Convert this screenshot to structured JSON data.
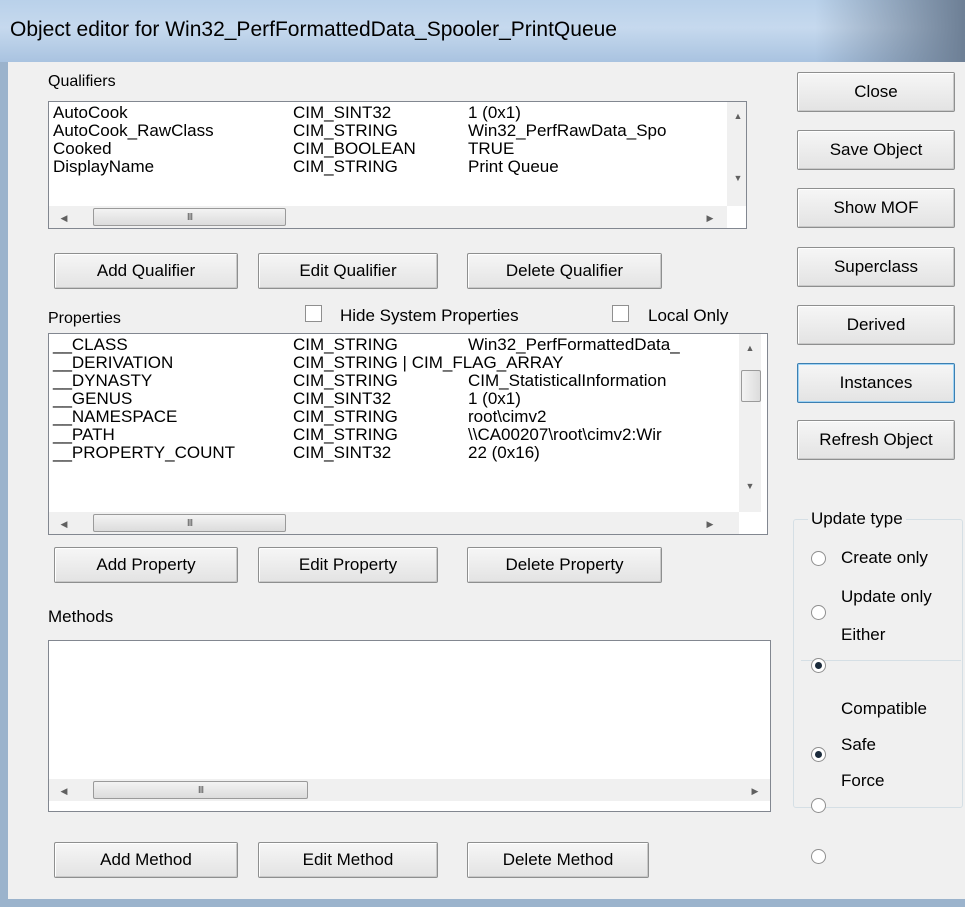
{
  "window": {
    "title": "Object editor for Win32_PerfFormattedData_Spooler_PrintQueue"
  },
  "qualifiers": {
    "label": "Qualifiers",
    "rows": [
      [
        "AutoCook",
        "CIM_SINT32",
        "1 (0x1)"
      ],
      [
        "AutoCook_RawClass",
        "CIM_STRING",
        "Win32_PerfRawData_Spo"
      ],
      [
        "Cooked",
        "CIM_BOOLEAN",
        "TRUE"
      ],
      [
        "DisplayName",
        "CIM_STRING",
        "Print Queue"
      ]
    ],
    "hthumb_glyph": "III",
    "add_label": "Add Qualifier",
    "edit_label": "Edit Qualifier",
    "delete_label": "Delete Qualifier"
  },
  "properties": {
    "label": "Properties",
    "hide_system_label": "Hide System Properties",
    "local_only_label": "Local Only",
    "rows": [
      [
        "__CLASS",
        "CIM_STRING",
        "Win32_PerfFormattedData_"
      ],
      [
        "__DERIVATION",
        "CIM_STRING | CIM_FLAG_ARRAY",
        ""
      ],
      [
        "__DYNASTY",
        "CIM_STRING",
        "CIM_StatisticalInformation"
      ],
      [
        "__GENUS",
        "CIM_SINT32",
        "1 (0x1)"
      ],
      [
        "__NAMESPACE",
        "CIM_STRING",
        "root\\cimv2"
      ],
      [
        "__PATH",
        "CIM_STRING",
        "\\\\CA00207\\root\\cimv2:Wir"
      ],
      [
        "__PROPERTY_COUNT",
        "CIM_SINT32",
        "22 (0x16)"
      ]
    ],
    "hthumb_glyph": "III",
    "add_label": "Add Property",
    "edit_label": "Edit Property",
    "delete_label": "Delete Property"
  },
  "methods": {
    "label": "Methods",
    "hthumb_glyph": "III",
    "add_label": "Add Method",
    "edit_label": "Edit Method",
    "delete_label": "Delete Method"
  },
  "side_buttons": {
    "close": "Close",
    "save_object": "Save Object",
    "show_mof": "Show MOF",
    "superclass": "Superclass",
    "derived": "Derived",
    "instances": "Instances",
    "refresh_object": "Refresh Object"
  },
  "update_type": {
    "label": "Update type",
    "options": [
      "Create only",
      "Update only",
      "Either"
    ],
    "selected": "Either",
    "mode_options": [
      "Compatible",
      "Safe",
      "Force"
    ],
    "mode_selected": "Compatible"
  }
}
